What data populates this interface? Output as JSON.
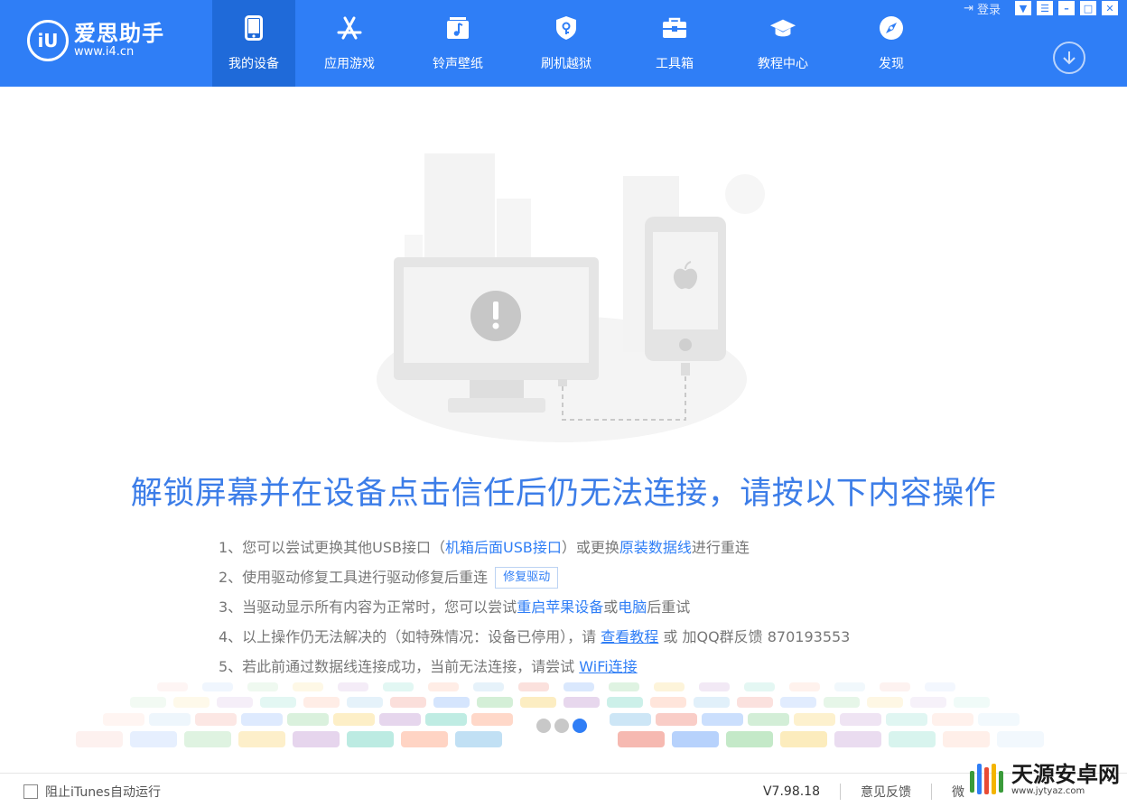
{
  "app": {
    "logo_mark": "iU",
    "name": "爱思助手",
    "url": "www.i4.cn"
  },
  "nav": [
    {
      "label": "我的设备",
      "icon": "phone-icon",
      "active": true
    },
    {
      "label": "应用游戏",
      "icon": "app-store-icon",
      "active": false
    },
    {
      "label": "铃声壁纸",
      "icon": "music-note-icon",
      "active": false
    },
    {
      "label": "刷机越狱",
      "icon": "shield-icon",
      "active": false
    },
    {
      "label": "工具箱",
      "icon": "toolbox-icon",
      "active": false
    },
    {
      "label": "教程中心",
      "icon": "graduation-cap-icon",
      "active": false
    },
    {
      "label": "发现",
      "icon": "compass-icon",
      "active": false
    }
  ],
  "window": {
    "login_label": "登录"
  },
  "main": {
    "headline": "解锁屏幕并在设备点击信任后仍无法连接，请按以下内容操作",
    "step1": {
      "a": "1、您可以尝试更换其他USB接口（",
      "b": "机箱后面USB接口",
      "c": "）或更换",
      "d": "原装数据线",
      "e": "进行重连"
    },
    "step2": {
      "a": "2、使用驱动修复工具进行驱动修复后重连",
      "button": "修复驱动"
    },
    "step3": {
      "a": "3、当驱动显示所有内容为正常时，您可以尝试",
      "b": "重启苹果设备",
      "c": "或",
      "d": "电脑",
      "e": "后重试"
    },
    "step4": {
      "a": "4、以上操作仍无法解决的（如特殊情况：设备已停用），请 ",
      "link": "查看教程",
      "b": " 或 加QQ群反馈 870193553"
    },
    "step5": {
      "a": "5、若此前通过数据线连接成功，当前无法连接，请尝试 ",
      "link": "WiFi连接"
    }
  },
  "footer": {
    "itunes_label": "阻止iTunes自动运行",
    "version": "V7.98.18",
    "feedback": "意见反馈",
    "wechat_partial": "微"
  },
  "watermark": {
    "name": "天源安卓网",
    "url": "www.jytyaz.com"
  },
  "colors": {
    "brand": "#2f7ef6",
    "nav_active": "#1f6ad9",
    "headline": "#3c7de8"
  }
}
